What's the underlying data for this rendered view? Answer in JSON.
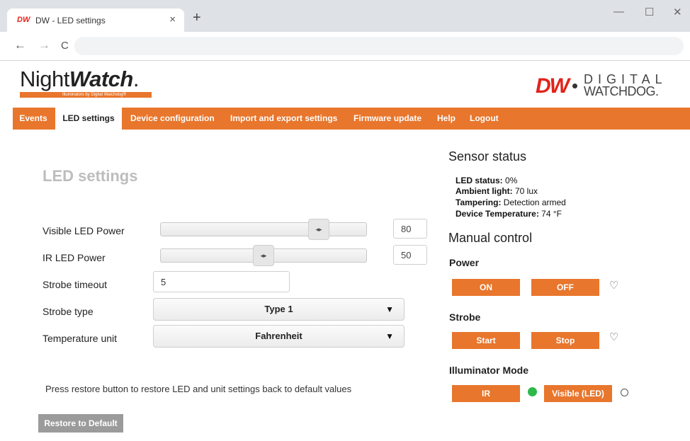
{
  "browser": {
    "tab_favicon": "DW",
    "tab_title": "DW - LED settings",
    "tab_close": "×",
    "new_tab": "+",
    "minimize": "—",
    "maximize": "☐",
    "close": "✕",
    "back": "←",
    "forward": "→",
    "reload": "C"
  },
  "header": {
    "logo_night": "Night",
    "logo_watch": "Watch",
    "logo_tm": ".",
    "logo_tagline": "Illuminators by Digital Watchdog®",
    "brand_mark": "DW",
    "brand_word1": "DIGITAL",
    "brand_word2": "WATCHDOG."
  },
  "menu": {
    "items": [
      "Events",
      "LED settings",
      "Device configuration",
      "Import and export settings",
      "Firmware update",
      "Help",
      "Logout"
    ],
    "active": "LED settings"
  },
  "settings": {
    "heading": "LED settings",
    "visible_led_label": "Visible LED Power",
    "visible_led_value": "80",
    "visible_led_fraction": 0.8,
    "ir_led_label": "IR LED Power",
    "ir_led_value": "50",
    "ir_led_fraction": 0.5,
    "slider_glyph": "◂▸",
    "strobe_timeout_label": "Strobe timeout",
    "strobe_timeout_value": "5",
    "strobe_type_label": "Strobe type",
    "strobe_type_value": "Type 1",
    "temperature_unit_label": "Temperature unit",
    "temperature_unit_value": "Fahrenheit",
    "dropdown_arrow": "▼",
    "restore_note": "Press restore button to restore LED and unit settings back to default values",
    "restore_button": "Restore to Default"
  },
  "sensor": {
    "title": "Sensor status",
    "led_status_key": "LED status:",
    "led_status_value": " 0%",
    "ambient_key": "Ambient light:",
    "ambient_value": " 70 lux",
    "tampering_key": "Tampering:",
    "tampering_value": " Detection armed",
    "temp_key": "Device Temperature:",
    "temp_value": " 74 °F"
  },
  "manual": {
    "title": "Manual control",
    "power_title": "Power",
    "power_on": "ON",
    "power_off": "OFF",
    "strobe_title": "Strobe",
    "strobe_start": "Start",
    "strobe_stop": "Stop",
    "mode_title": "Illuminator Mode",
    "mode_ir": "IR",
    "mode_visible": "Visible (LED)",
    "bulb_glyph": "♡"
  },
  "colors": {
    "accent": "#e8762c",
    "brand_red": "#e2231a",
    "indicator_on": "#2db84c"
  }
}
